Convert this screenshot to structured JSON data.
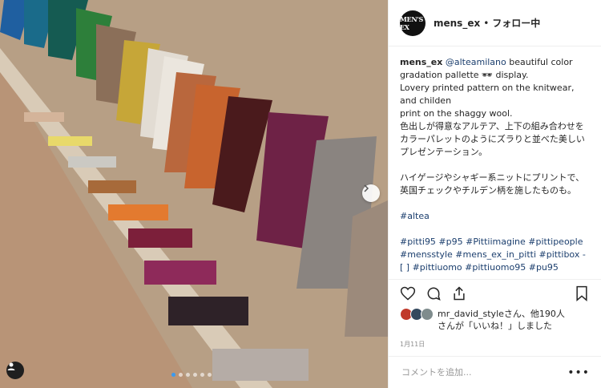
{
  "post": {
    "image_alt": "Racks of colorful clothing arranged in color gradation on a wall display",
    "carousel": {
      "dots_total": 6,
      "active_index": 0
    }
  },
  "header": {
    "avatar_text": "MEN'S EX",
    "username": "mens_ex",
    "separator": "•",
    "follow_state": "フォロー中"
  },
  "caption": {
    "username": "mens_ex",
    "mention": "@alteamilano",
    "lines": [
      "beautiful color gradation pallette 🕶 display.",
      "Lovery printed pattern on the knitwear, and childen",
      "print on the shaggy wool.",
      "色出しが得意なアルテア、上下の組み合わせをカラーパレットのようにズラりと並べた美しいプレゼンテーション。"
    ],
    "paragraph2": "ハイゲージやシャギー系ニットにプリントで、英国チェックやチルデン柄を施したものも。",
    "hashtag_single": "#altea",
    "hashtags": "#pitti95 #p95 #Pittiimagine #pittipeople #mensstyle #mens_ex_in_pitti #pittibox - [ ] #pittiuomo #pittiuomo95 #pu95"
  },
  "actions": {
    "like_icon": "heart-icon",
    "comment_icon": "comment-bubble-icon",
    "share_icon": "share-icon",
    "save_icon": "bookmark-icon"
  },
  "likes": {
    "text_line1": "mr_david_styleさん、他190人",
    "text_line2": "さんが「いいね！」しました",
    "avatar_colors": [
      "#c0392b",
      "#34495e",
      "#7f8c8d"
    ]
  },
  "date": "1月11日",
  "comment": {
    "placeholder": "コメントを追加...",
    "more_label": "•••"
  }
}
